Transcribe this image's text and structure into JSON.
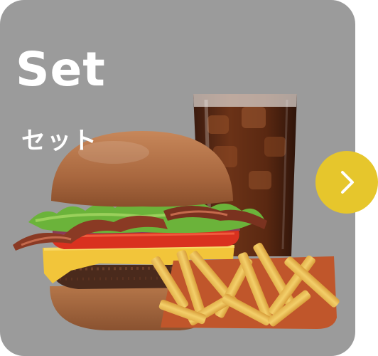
{
  "card": {
    "title": "Set",
    "subtitle": "セット",
    "image": "burger-drink-fries-set",
    "background_color": "#9b9b9b"
  },
  "next_button": {
    "icon": "chevron-right-icon",
    "color": "#e6c62c"
  }
}
